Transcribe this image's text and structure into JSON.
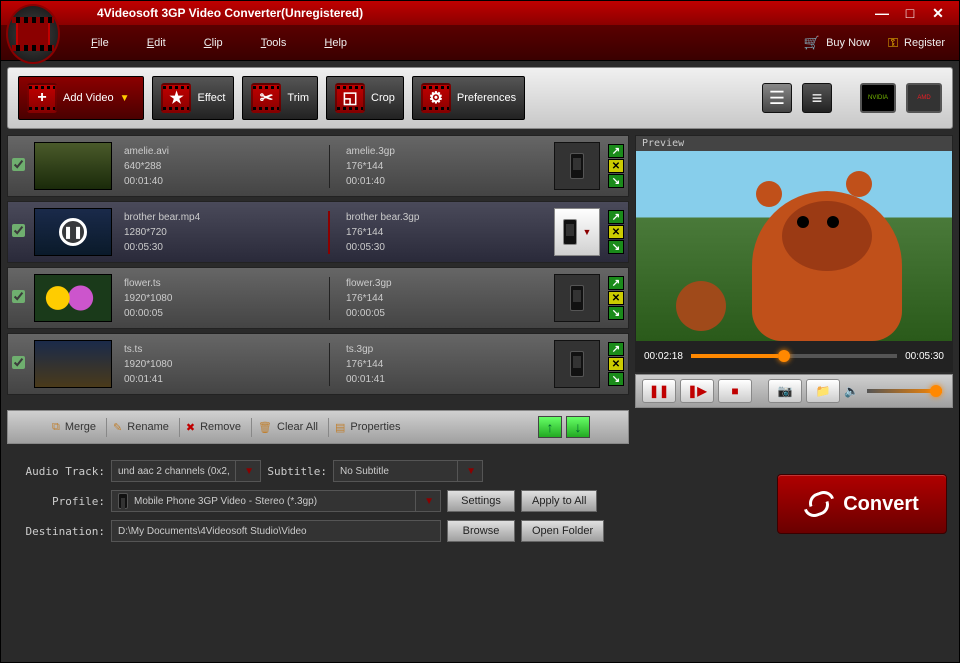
{
  "title": "4Videosoft 3GP Video Converter(Unregistered)",
  "menu": {
    "file": "File",
    "edit": "Edit",
    "clip": "Clip",
    "tools": "Tools",
    "help": "Help",
    "buy": "Buy Now",
    "register": "Register"
  },
  "toolbar": {
    "add": "Add Video",
    "effect": "Effect",
    "trim": "Trim",
    "crop": "Crop",
    "prefs": "Preferences"
  },
  "gpu": {
    "nvidia": "NVIDIA",
    "amd": "AMD"
  },
  "files": [
    {
      "name": "amelie.avi",
      "res": "640*288",
      "dur": "00:01:40",
      "out": "amelie.3gp",
      "ores": "176*144",
      "odur": "00:01:40",
      "selected": false
    },
    {
      "name": "brother bear.mp4",
      "res": "1280*720",
      "dur": "00:05:30",
      "out": "brother bear.3gp",
      "ores": "176*144",
      "odur": "00:05:30",
      "selected": true
    },
    {
      "name": "flower.ts",
      "res": "1920*1080",
      "dur": "00:00:05",
      "out": "flower.3gp",
      "ores": "176*144",
      "odur": "00:00:05",
      "selected": false
    },
    {
      "name": "ts.ts",
      "res": "1920*1080",
      "dur": "00:01:41",
      "out": "ts.3gp",
      "ores": "176*144",
      "odur": "00:01:41",
      "selected": false
    }
  ],
  "listbar": {
    "merge": "Merge",
    "rename": "Rename",
    "remove": "Remove",
    "clear": "Clear All",
    "props": "Properties"
  },
  "preview": {
    "label": "Preview",
    "pos": "00:02:18",
    "dur": "00:05:30"
  },
  "bottom": {
    "audio_label": "Audio Track:",
    "audio_value": "und aac 2 channels (0x2,",
    "subtitle_label": "Subtitle:",
    "subtitle_value": "No Subtitle",
    "profile_label": "Profile:",
    "profile_value": "Mobile Phone 3GP Video - Stereo (*.3gp)",
    "dest_label": "Destination:",
    "dest_value": "D:\\My Documents\\4Videosoft Studio\\Video",
    "settings": "Settings",
    "apply": "Apply to All",
    "browse": "Browse",
    "open": "Open Folder",
    "convert": "Convert"
  }
}
